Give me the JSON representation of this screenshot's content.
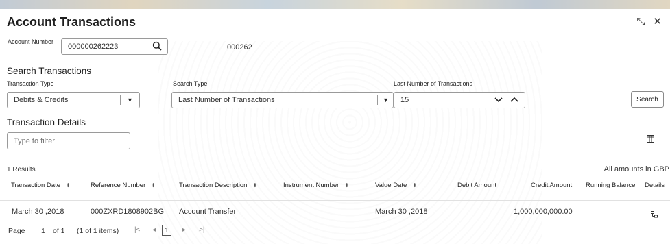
{
  "window": {
    "title": "Account Transactions",
    "icons": [
      "collapse-icon",
      "close-icon"
    ]
  },
  "account": {
    "label": "Account Number",
    "value": "000000262223",
    "branch": "000262",
    "search_icon": "search-icon"
  },
  "search": {
    "section_title": "Search Transactions",
    "transaction_type": {
      "label": "Transaction Type",
      "value": "Debits & Credits"
    },
    "search_type": {
      "label": "Search Type",
      "value": "Last Number of Transactions"
    },
    "last_number": {
      "label": "Last Number of Transactions",
      "value": "15"
    },
    "button_label": "Search"
  },
  "details": {
    "section_title": "Transaction Details",
    "filter_placeholder": "Type to filter",
    "columns_icon": "columns-icon",
    "results_text": "1 Results",
    "currency_note": "All amounts in GBP"
  },
  "table": {
    "columns": [
      "Transaction Date",
      "Reference Number",
      "Transaction Description",
      "Instrument Number",
      "Value Date",
      "Debit Amount",
      "Credit Amount",
      "Running Balance",
      "Details"
    ],
    "rows": [
      {
        "transaction_date": "March 30 ,2018",
        "reference_number": "000ZXRD1808902BG",
        "description": "Account Transfer",
        "instrument_number": "",
        "value_date": "March 30 ,2018",
        "debit_amount": "",
        "credit_amount": "1,000,000,000.00",
        "running_balance": "",
        "details_icon": "details-icon"
      }
    ]
  },
  "pagination": {
    "page_label": "Page",
    "current_page": "1",
    "of_total": "of 1",
    "items_summary": "(1 of 1 items)",
    "page_button": "1"
  }
}
